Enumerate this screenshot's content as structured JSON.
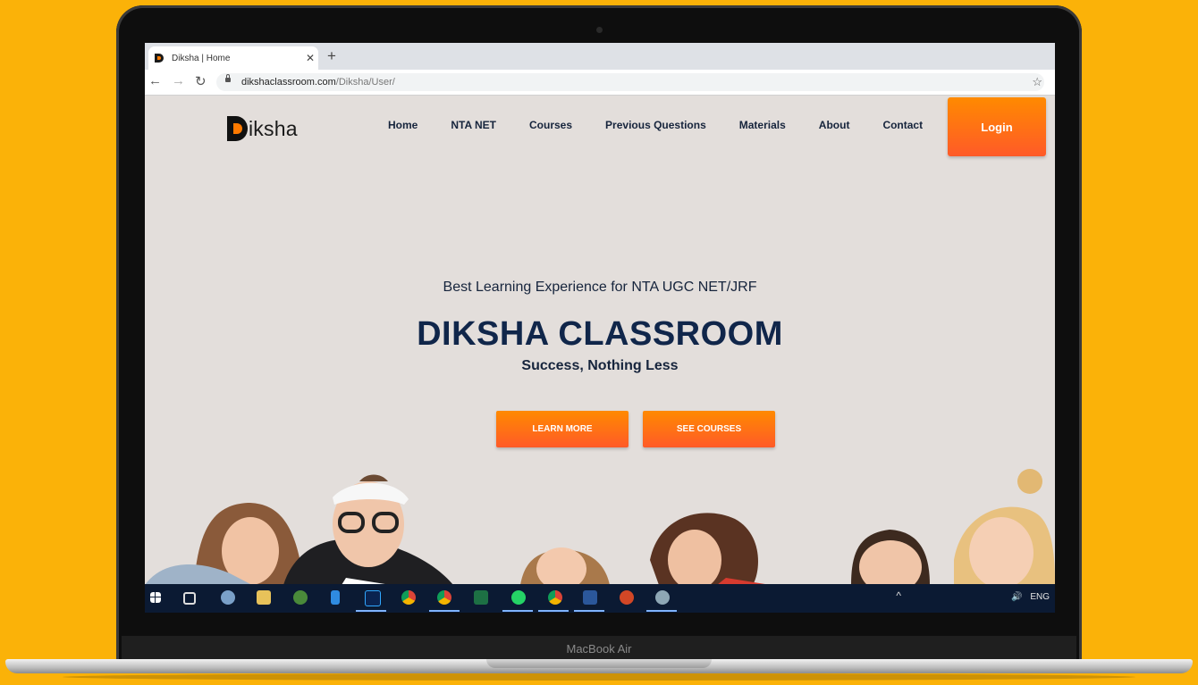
{
  "device": {
    "label": "MacBook Air"
  },
  "browser": {
    "tab_title": "Diksha | Home",
    "url_host": "dikshaclassroom.com",
    "url_path": "/Diksha/User/"
  },
  "site": {
    "logo_text": "iksha",
    "nav": [
      "Home",
      "NTA NET",
      "Courses",
      "Previous Questions",
      "Materials",
      "About",
      "Contact"
    ],
    "login_label": "Login",
    "hero": {
      "kicker": "Best Learning Experience for NTA UGC NET/JRF",
      "title": "DIKSHA CLASSROOM",
      "subtitle": "Success, Nothing Less"
    },
    "buttons": {
      "learn_more": "LEARN MORE",
      "see_courses": "SEE COURSES"
    }
  },
  "taskbar": {
    "language": "ENG"
  },
  "colors": {
    "background": "#FBB208",
    "accent": "#FF6A1A",
    "navy": "#10264A"
  }
}
